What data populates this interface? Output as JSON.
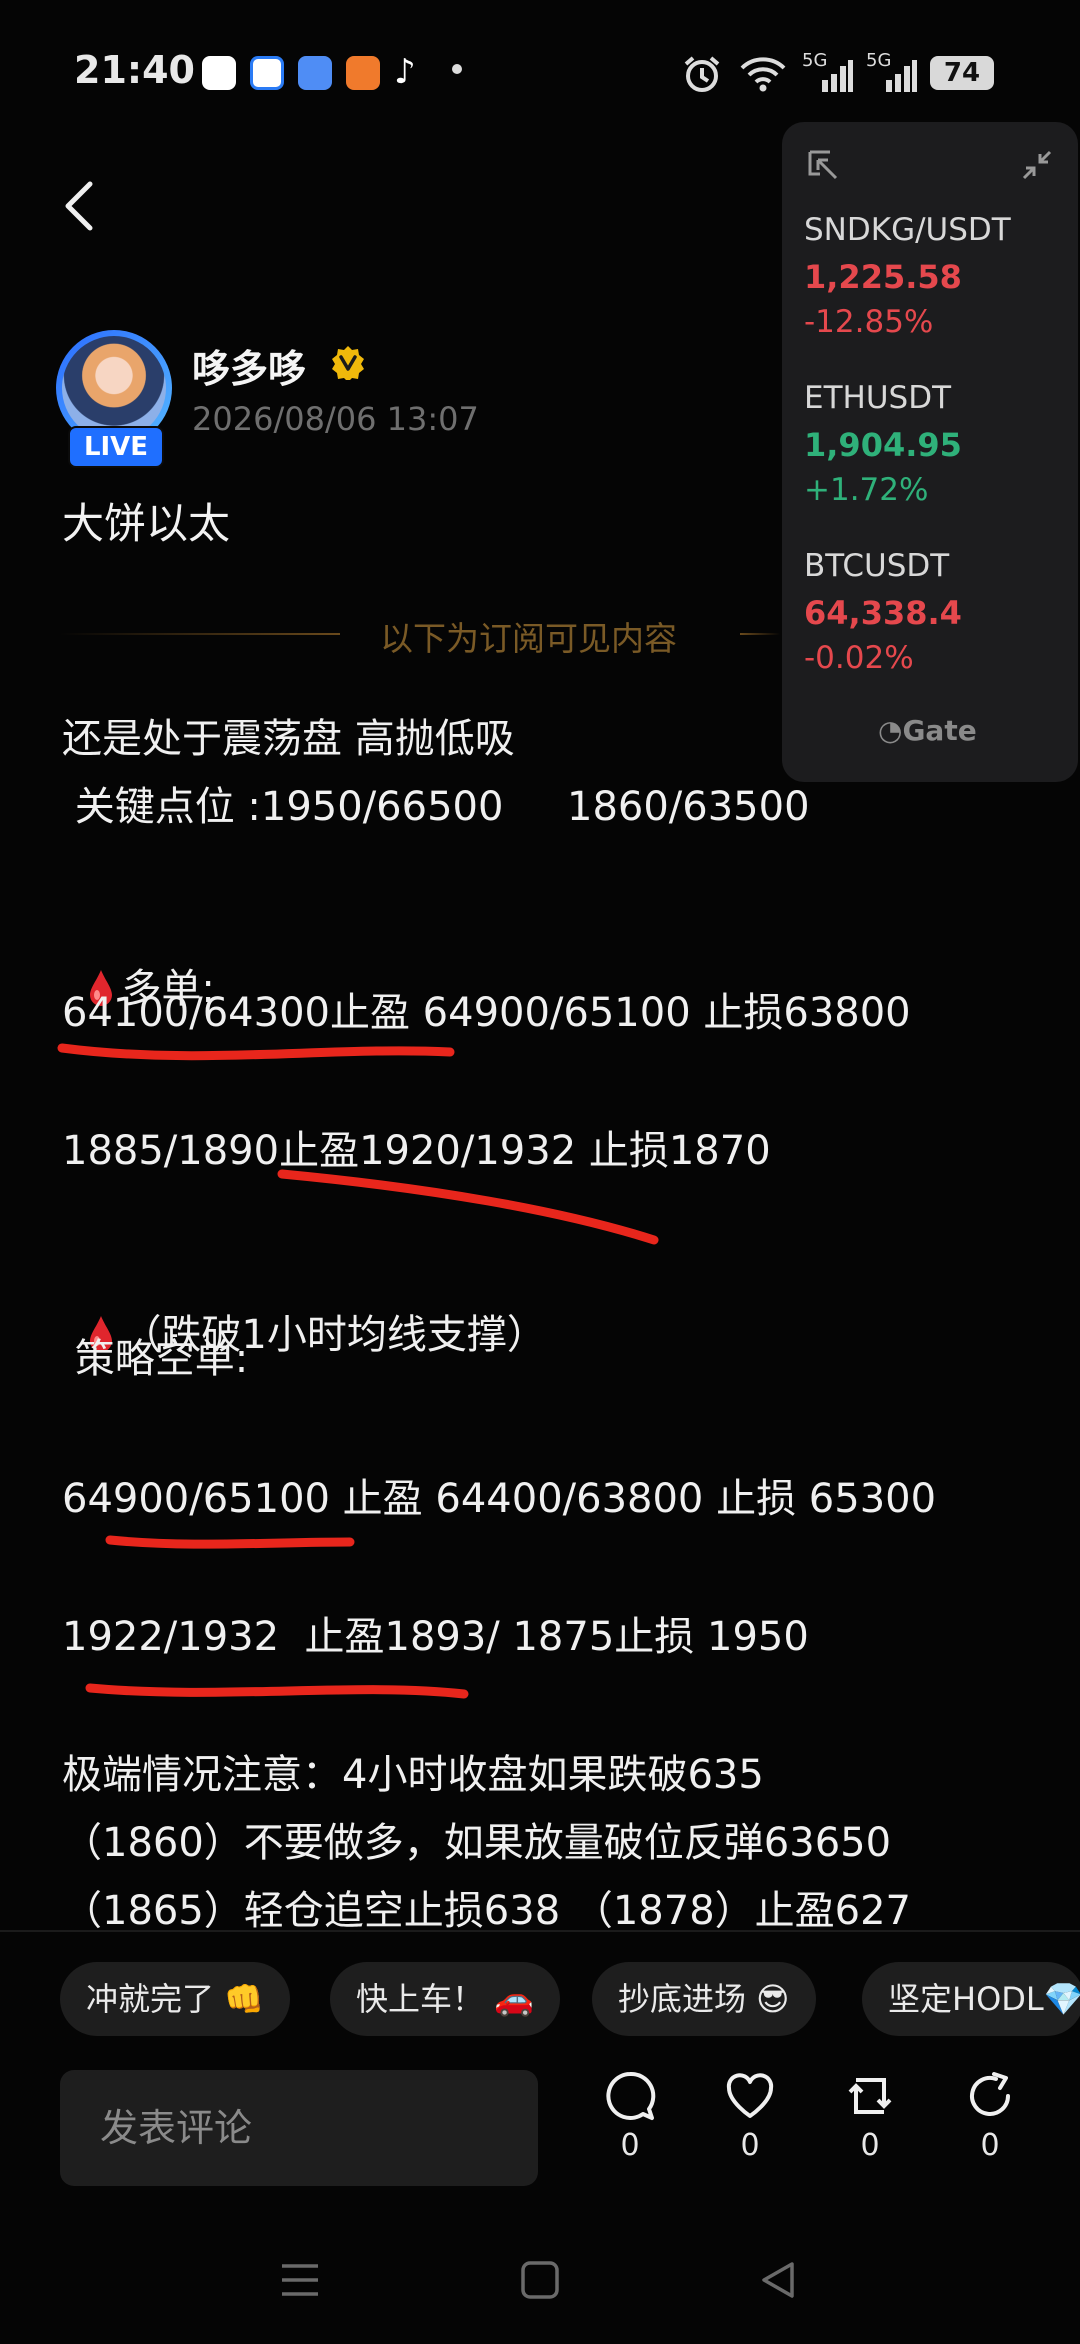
{
  "status_bar": {
    "time": "21:40",
    "signal_1": "5G",
    "signal_2": "5G",
    "battery": "74",
    "icons": [
      "app-icon-sant",
      "app-icon-blue",
      "app-icon-cloud",
      "app-icon-orange",
      "tiktok-icon",
      "dot-icon",
      "alarm-icon",
      "wifi-icon",
      "signal-icon",
      "signal-icon",
      "battery-icon"
    ]
  },
  "post": {
    "author": "哆多哆",
    "timestamp": "2026/08/06 13:07",
    "live_badge": "LIVE",
    "title": "大饼以太",
    "subscription_divider": "以下为订阅可见内容",
    "lines": {
      "l1": "还是处于震荡盘 高抛低吸",
      "l2": " 关键点位 :1950/66500     1860/63500",
      "l3": "多单:",
      "l4": "64100/64300止盈 64900/65100 止损63800",
      "l5": "1885/1890止盈1920/1932 止损1870",
      "l6": "（跌破1小时均线支撑）",
      "l7": " 策略空单:",
      "l8": "64900/65100 止盈 64400/63800 止损 65300",
      "l9": "1922/1932  止盈1893/ 1875止损 1950",
      "l10": "极端情况注意：4小时收盘如果跌破635",
      "l11": "（1860）不要做多，如果放量破位反弹63650",
      "l12": "（1865）轻仓追空止损638 （1878）止盈627"
    },
    "annotation_color": "#e8261c"
  },
  "ticker": {
    "items": [
      {
        "pair": "SNDKG/USDT",
        "price": "1,225.58",
        "change": "-12.85%"
      },
      {
        "pair": "ETHUSDT",
        "price": "1,904.95",
        "change": "+1.72%"
      },
      {
        "pair": "BTCUSDT",
        "price": "64,338.4",
        "change": "-0.02%"
      }
    ],
    "brand": "Gate",
    "colors": {
      "up": "#2fb17a",
      "down": "#e5484d"
    }
  },
  "quick_replies": [
    "冲就完了 👊",
    "快上车！ 🚗",
    "抄底进场 😎",
    "坚定HODL💎"
  ],
  "comment": {
    "placeholder": "发表评论"
  },
  "actions": {
    "comments": "0",
    "likes": "0",
    "reposts": "0",
    "shares": "0"
  }
}
